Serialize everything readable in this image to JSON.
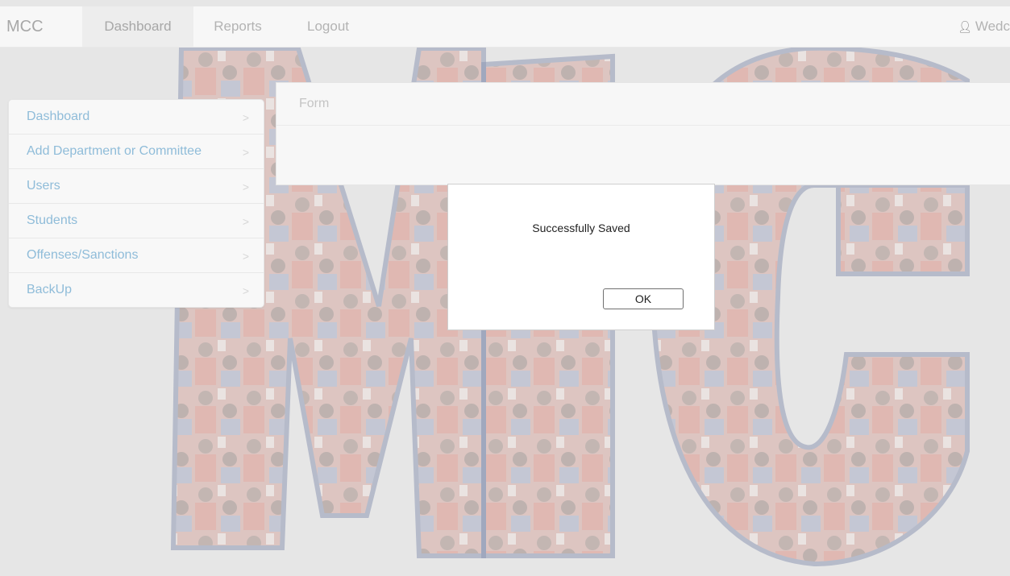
{
  "navbar": {
    "brand": "MCC",
    "items": [
      {
        "label": "Dashboard"
      },
      {
        "label": "Reports"
      },
      {
        "label": "Logout"
      }
    ],
    "user": "Wedc"
  },
  "sidebar": {
    "items": [
      {
        "label": "Dashboard"
      },
      {
        "label": "Add Department or Committee"
      },
      {
        "label": "Users"
      },
      {
        "label": "Students"
      },
      {
        "label": "Offenses/Sanctions"
      },
      {
        "label": "BackUp"
      }
    ]
  },
  "panel": {
    "title": "Form"
  },
  "dialog": {
    "message": "Successfully Saved",
    "ok_label": "OK"
  },
  "colors": {
    "link": "#6aa6cc",
    "background_letters": "#4a5b8c",
    "background_fill": "#c0503a"
  }
}
